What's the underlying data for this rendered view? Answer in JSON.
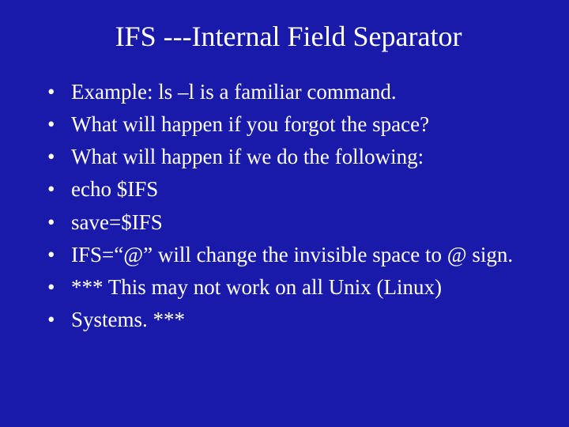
{
  "title": "IFS ---Internal Field Separator",
  "bullets": [
    "Example: ls –l  is a familiar command.",
    "What will happen if you forgot the space?",
    "What will happen if we do the following:",
    "echo $IFS",
    "save=$IFS",
    "IFS=“@” will change the invisible space to @ sign.",
    "*** This may not work on all Unix (Linux)",
    "Systems. ***"
  ]
}
